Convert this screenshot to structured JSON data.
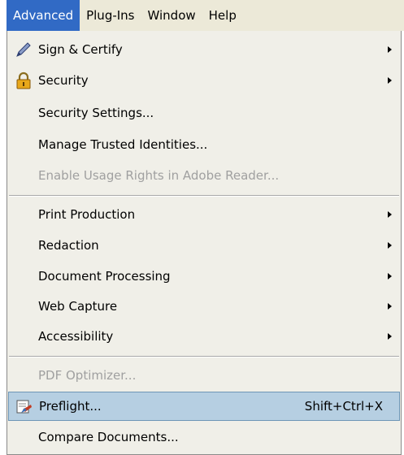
{
  "menubar": {
    "items": [
      {
        "label": "Advanced"
      },
      {
        "label": "Plug-Ins"
      },
      {
        "label": "Window"
      },
      {
        "label": "Help"
      }
    ]
  },
  "menu": {
    "sign_certify": "Sign & Certify",
    "security": "Security",
    "security_settings": "Security Settings...",
    "manage_identities": "Manage Trusted Identities...",
    "enable_usage_rights": "Enable Usage Rights in Adobe Reader...",
    "print_production": "Print Production",
    "redaction": "Redaction",
    "document_processing": "Document Processing",
    "web_capture": "Web Capture",
    "accessibility": "Accessibility",
    "pdf_optimizer": "PDF Optimizer...",
    "preflight": "Preflight...",
    "preflight_shortcut": "Shift+Ctrl+X",
    "compare_documents": "Compare Documents..."
  },
  "icons": {
    "sign": "pen-icon",
    "security": "lock-icon",
    "preflight": "preflight-icon"
  },
  "colors": {
    "menubar_active": "#316ac5",
    "highlight": "#b6cfe2",
    "disabled_text": "#a0a0a0"
  }
}
